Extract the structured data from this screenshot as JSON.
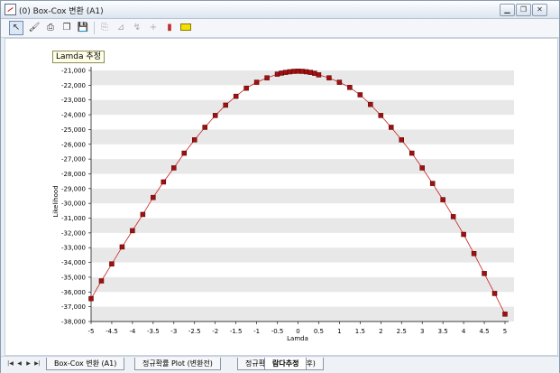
{
  "window": {
    "title": "(0) Box-Cox 변환 (A1)"
  },
  "toolbar": {
    "icons": [
      "pointer-icon",
      "paint-icon",
      "print-icon",
      "copy-icon",
      "save-icon",
      "disabled-icon-1",
      "disabled-icon-2",
      "disabled-icon-3",
      "disabled-icon-4",
      "marker-icon",
      "highlight-icon"
    ]
  },
  "chart": {
    "label": "Lamda 추정"
  },
  "chart_data": {
    "type": "scatter",
    "xlabel": "Lamda",
    "ylabel": "Likelihood",
    "xlim": [
      -5,
      5
    ],
    "ylim": [
      -38000,
      -21000
    ],
    "xticks": [
      "-5",
      "-4.5",
      "-4",
      "-3.5",
      "-3",
      "-2.5",
      "-2",
      "-1.5",
      "-1",
      "-0.5",
      "0",
      "0.5",
      "1",
      "1.5",
      "2",
      "2.5",
      "3",
      "3.5",
      "4",
      "4.5",
      "5"
    ],
    "yticks": [
      "-21,000",
      "-22,000",
      "-23,000",
      "-24,000",
      "-25,000",
      "-26,000",
      "-27,000",
      "-28,000",
      "-29,000",
      "-30,000",
      "-31,000",
      "-32,000",
      "-33,000",
      "-34,000",
      "-35,000",
      "-36,000",
      "-37,000",
      "-38,000"
    ],
    "grid": true,
    "series": [
      {
        "color": "#a01010",
        "x": [
          -5,
          -4.75,
          -4.5,
          -4.25,
          -4,
          -3.75,
          -3.5,
          -3.25,
          -3,
          -2.75,
          -2.5,
          -2.25,
          -2,
          -1.75,
          -1.5,
          -1.25,
          -1,
          -0.75,
          -0.5,
          -0.4,
          -0.3,
          -0.2,
          -0.1,
          0,
          0.1,
          0.2,
          0.3,
          0.4,
          0.5,
          0.75,
          1,
          1.25,
          1.5,
          1.75,
          2,
          2.25,
          2.5,
          2.75,
          3,
          3.25,
          3.5,
          3.75,
          4,
          4.25,
          4.5,
          4.75,
          5
        ],
        "y": [
          -36450,
          -35250,
          -34100,
          -32950,
          -31850,
          -30750,
          -29600,
          -28550,
          -27600,
          -26600,
          -25700,
          -24850,
          -24050,
          -23350,
          -22750,
          -22200,
          -21800,
          -21500,
          -21250,
          -21180,
          -21130,
          -21090,
          -21060,
          -21050,
          -21060,
          -21090,
          -21130,
          -21190,
          -21300,
          -21500,
          -21800,
          -22150,
          -22650,
          -23300,
          -24050,
          -24850,
          -25700,
          -26600,
          -27600,
          -28650,
          -29750,
          -30900,
          -32100,
          -33400,
          -34750,
          -36100,
          -37500
        ]
      }
    ]
  },
  "tabs": {
    "nav": [
      "|◀",
      "◀",
      "▶",
      "▶|"
    ],
    "items": [
      {
        "label": "Box-Cox 변환 (A1)"
      },
      {
        "label": "정규확률 Plot (변환전)"
      },
      {
        "label": "정규확률 Plot (변환후)"
      },
      {
        "label": "람다추정"
      }
    ]
  }
}
